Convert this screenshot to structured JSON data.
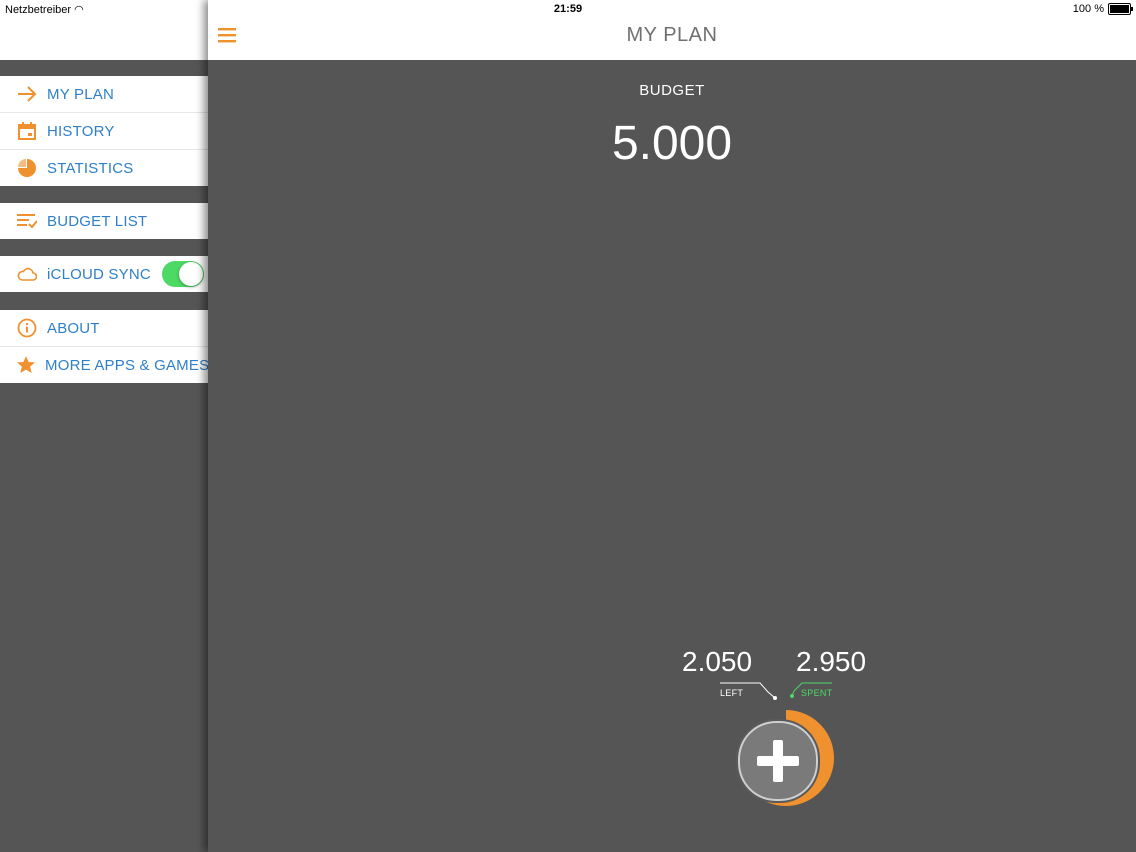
{
  "status_bar": {
    "carrier": "Netzbetreiber",
    "time": "21:59",
    "battery": "100 %"
  },
  "sidebar": {
    "groups": [
      {
        "items": [
          {
            "label": "MY PLAN",
            "icon": "arrow-right-icon"
          },
          {
            "label": "HISTORY",
            "icon": "calendar-icon"
          },
          {
            "label": "STATISTICS",
            "icon": "pie-chart-icon"
          }
        ]
      },
      {
        "items": [
          {
            "label": "BUDGET LIST",
            "icon": "list-check-icon"
          }
        ]
      },
      {
        "items": [
          {
            "label": "iCLOUD SYNC",
            "icon": "cloud-icon",
            "toggle_on": true
          }
        ]
      },
      {
        "items": [
          {
            "label": "ABOUT",
            "icon": "info-icon"
          },
          {
            "label": "MORE APPS & GAMES",
            "icon": "star-icon"
          }
        ]
      }
    ]
  },
  "header": {
    "title": "MY PLAN",
    "menu_icon": "hamburger-icon"
  },
  "main": {
    "budget_label": "BUDGET",
    "budget_value": "5.000",
    "left_value": "2.050",
    "left_label": "LEFT",
    "spent_value": "2.950",
    "spent_label": "SPENT",
    "spent_fraction": 0.59,
    "add_icon": "plus-icon"
  },
  "colors": {
    "accent_orange": "#f0912f",
    "link_blue": "#2f7fc9",
    "background": "#555556",
    "toggle_green": "#4cd964"
  }
}
